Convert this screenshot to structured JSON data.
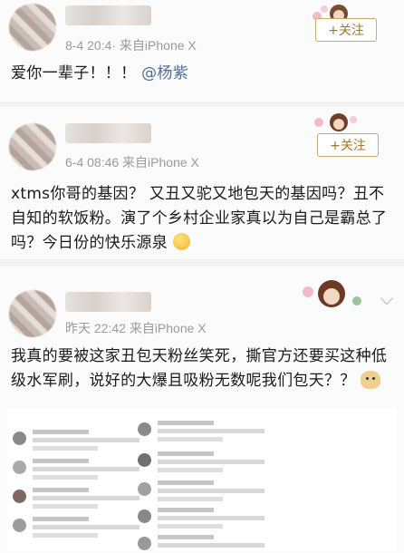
{
  "posts": [
    {
      "meta": "8-4 20:4· 来自iPhone X",
      "follow_label": "+关注",
      "text": "爱你一辈子！！！",
      "mention": "@杨紫"
    },
    {
      "meta": "6-4 08:46  来自iPhone X",
      "follow_label": "+关注",
      "text": "xtms你哥的基因？ 又丑又驼又地包天的基因吗？丑不自知的软饭粉。演了个乡村企业家真以为自己是霸总了吗？今日份的快乐源泉"
    },
    {
      "meta": "昨天 22:42  来自iPhone X",
      "text": "我真的要被这家丑包天粉丝笑死，撕官方还要买这种低级水军刷，说好的大爆且吸粉无数呢我们包天？？"
    }
  ],
  "colors": {
    "follow_border": "#c9a872",
    "follow_text": "#a4762f",
    "mention": "#506d98",
    "meta": "#9a9a9a"
  }
}
